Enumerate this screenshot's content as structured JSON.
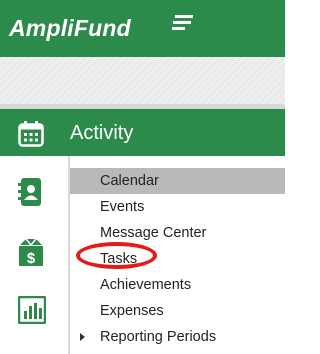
{
  "header": {
    "logo_text": "AmpliFund",
    "logo_icon": "amplifund-flag-icon",
    "brand_color": "#2c8b4a"
  },
  "section": {
    "title": "Activity",
    "icon": "calendar-icon"
  },
  "rail": {
    "icons": [
      "contacts-icon",
      "funds-box-icon",
      "reports-chart-icon"
    ]
  },
  "menu": {
    "items": [
      {
        "label": "Calendar",
        "selected": true
      },
      {
        "label": "Events"
      },
      {
        "label": "Message Center"
      },
      {
        "label": "Tasks",
        "circled": true
      },
      {
        "label": "Achievements"
      },
      {
        "label": "Expenses"
      },
      {
        "label": "Reporting Periods",
        "expandable": true
      }
    ]
  },
  "annotation": {
    "circle_color": "#e31b1b",
    "circled_item": "Tasks"
  }
}
